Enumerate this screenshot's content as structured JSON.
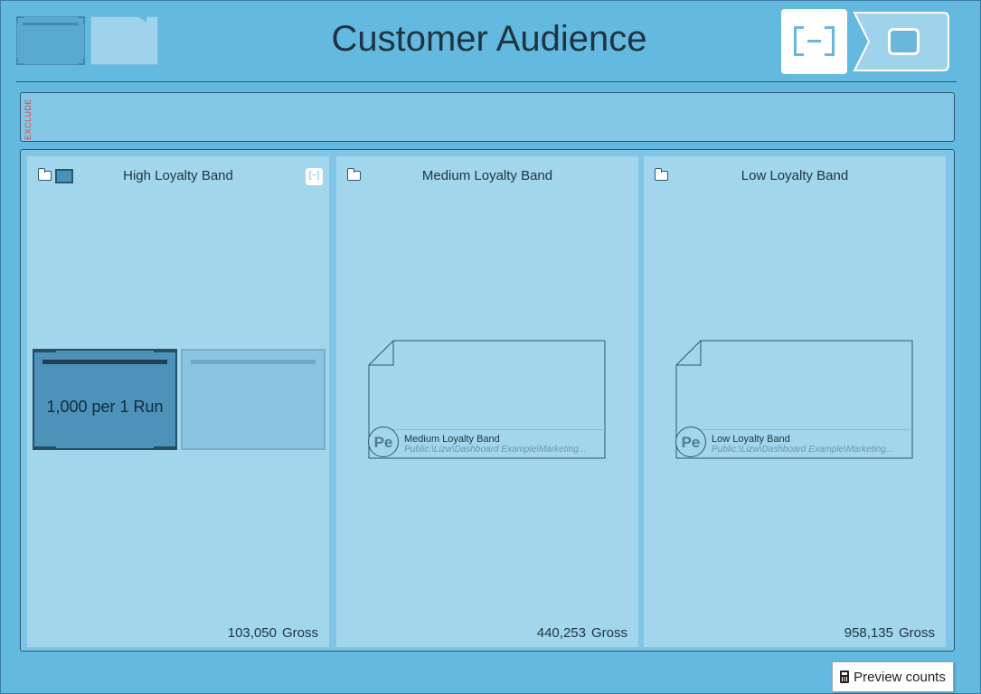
{
  "header": {
    "title": "Customer Audience"
  },
  "exclude": {
    "label": "EXCLUDE"
  },
  "bands": [
    {
      "title": "High Loyalty Band",
      "count": "103,050",
      "count_label": "Gross",
      "cells": [
        {
          "label": "1,000 per 1 Run",
          "state": "selected"
        },
        {
          "label": "",
          "state": "unselected"
        }
      ]
    },
    {
      "title": "Medium Loyalty Band",
      "count": "440,253",
      "count_label": "Gross",
      "document": {
        "badge": "Pe",
        "name": "Medium Loyalty Band",
        "path": "Public:\\Lizw\\Dashboard Example\\Marketing..."
      }
    },
    {
      "title": "Low Loyalty Band",
      "count": "958,135",
      "count_label": "Gross",
      "document": {
        "badge": "Pe",
        "name": "Low Loyalty Band",
        "path": "Public:\\Lizw\\Dashboard Example\\Marketing..."
      }
    }
  ],
  "footer": {
    "preview_label": "Preview counts"
  },
  "colors": {
    "background": "#63b9e0",
    "panel": "#a1d6ec",
    "exclude_label": "#e04040",
    "title_text": "#1f3442"
  }
}
